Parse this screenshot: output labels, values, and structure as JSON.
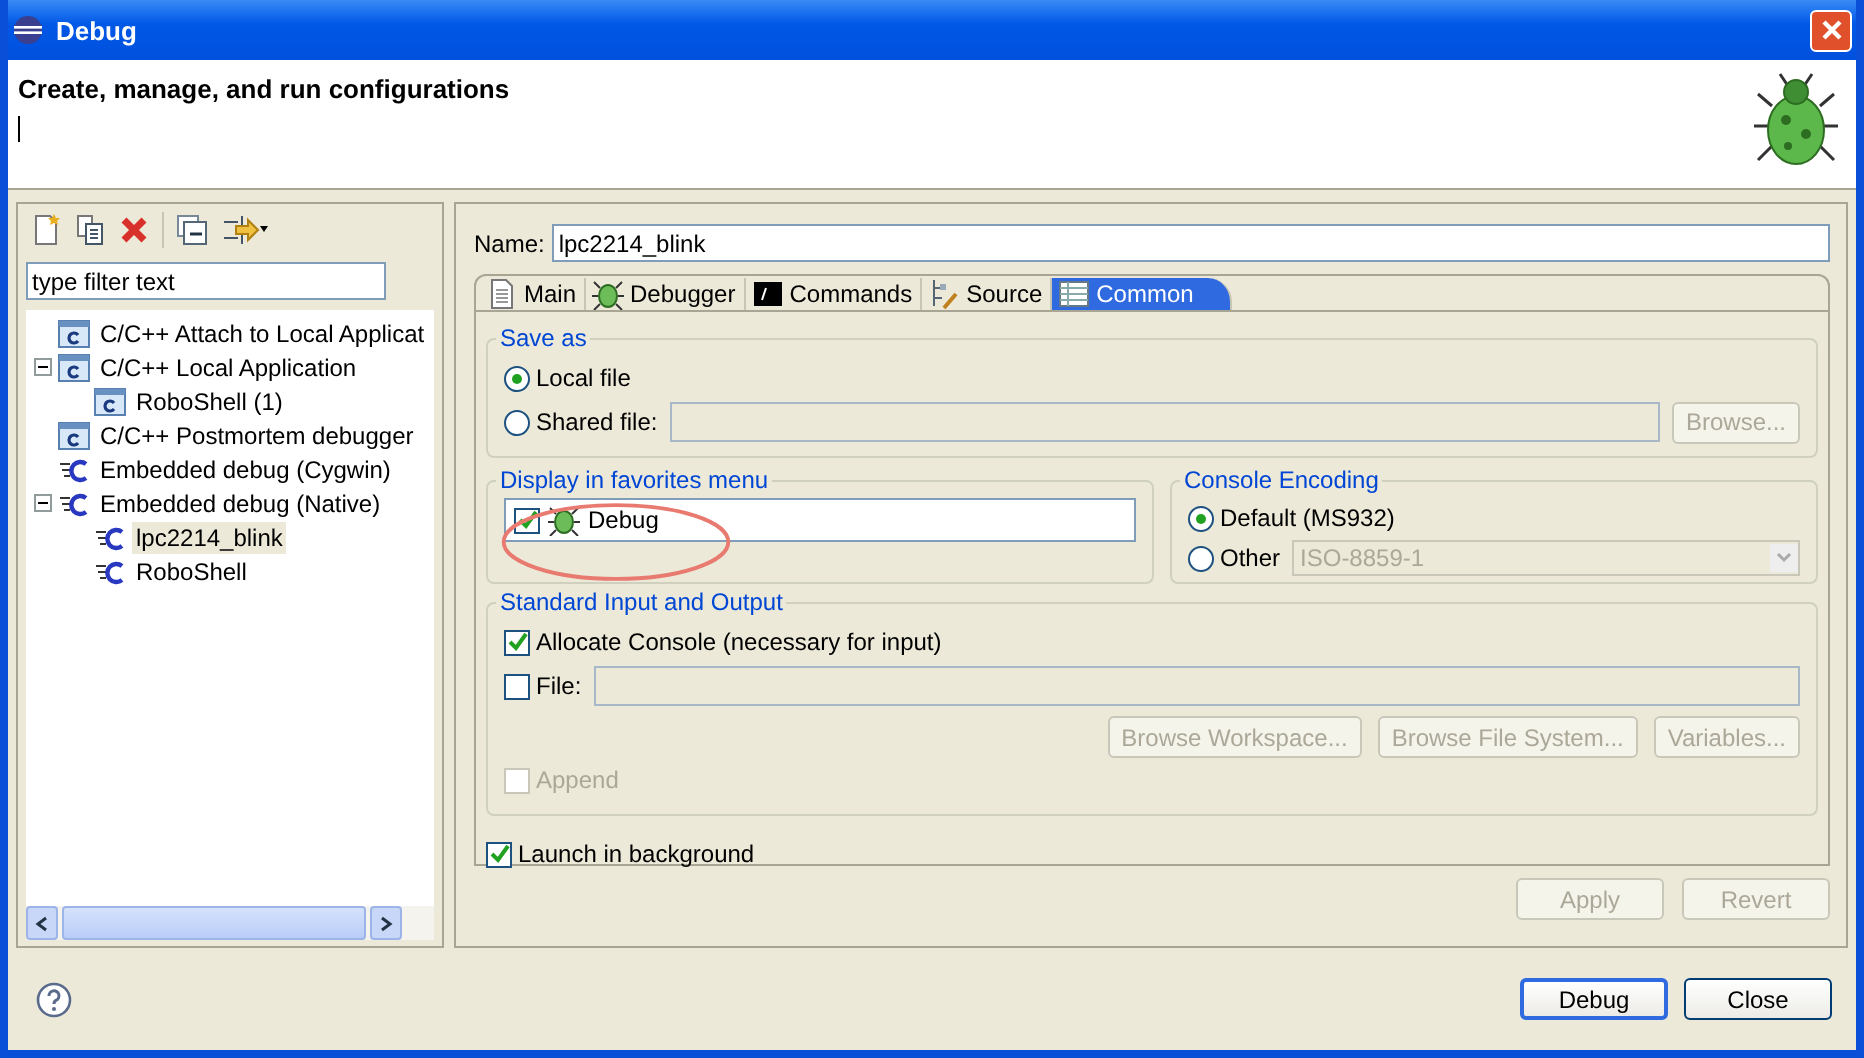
{
  "window": {
    "title": "Debug"
  },
  "header": {
    "title": "Create, manage, and run configurations"
  },
  "filter": {
    "placeholder": "type filter text"
  },
  "tree": [
    {
      "label": "C/C++ Attach to Local Applicat",
      "kind": "window",
      "selected": false
    },
    {
      "label": "C/C++ Local Application",
      "kind": "window",
      "selected": false,
      "expanded": true,
      "children": [
        {
          "label": "RoboShell (1)",
          "kind": "window",
          "selected": false
        }
      ]
    },
    {
      "label": "C/C++ Postmortem debugger",
      "kind": "window",
      "selected": false
    },
    {
      "label": "Embedded debug (Cygwin)",
      "kind": "embedded",
      "selected": false
    },
    {
      "label": "Embedded debug (Native)",
      "kind": "embedded",
      "selected": false,
      "expanded": true,
      "children": [
        {
          "label": "lpc2214_blink",
          "kind": "embedded",
          "selected": true
        },
        {
          "label": "RoboShell",
          "kind": "embedded",
          "selected": false
        }
      ]
    }
  ],
  "name_field": {
    "label": "Name:",
    "value": "lpc2214_blink"
  },
  "tabs": [
    {
      "label": "Main",
      "kind": "page",
      "selected": false
    },
    {
      "label": "Debugger",
      "kind": "bug",
      "selected": false
    },
    {
      "label": "Commands",
      "kind": "console",
      "selected": false
    },
    {
      "label": "Source",
      "kind": "source",
      "selected": false
    },
    {
      "label": "Common",
      "kind": "table",
      "selected": true
    }
  ],
  "save_as": {
    "title": "Save as",
    "options": [
      {
        "label": "Local file",
        "selected": true
      },
      {
        "label": "Shared file:",
        "selected": false
      }
    ],
    "browse": {
      "label": "Browse...",
      "disabled": true
    }
  },
  "favorites": {
    "title": "Display in favorites menu",
    "items": [
      {
        "label": "Debug",
        "checked": true
      }
    ]
  },
  "console_encoding": {
    "title": "Console Encoding",
    "options": [
      {
        "label": "Default (MS932)",
        "selected": true
      },
      {
        "label": "Other",
        "selected": false
      }
    ],
    "encoding": "ISO-8859-1"
  },
  "std_io": {
    "title": "Standard Input and Output",
    "allocate": {
      "label": "Allocate Console (necessary for input)",
      "checked": true
    },
    "file": {
      "label": "File:",
      "checked": false
    },
    "buttons": [
      {
        "label": "Browse Workspace...",
        "disabled": true
      },
      {
        "label": "Browse File System...",
        "disabled": true
      },
      {
        "label": "Variables...",
        "disabled": true
      }
    ],
    "append": {
      "label": "Append",
      "checked": false,
      "disabled": true
    }
  },
  "launch_background": {
    "label": "Launch in background",
    "checked": true
  },
  "panel_buttons": [
    {
      "label": "Apply",
      "disabled": true
    },
    {
      "label": "Revert",
      "disabled": true
    }
  ],
  "dialog_buttons": [
    {
      "label": "Debug",
      "default": true
    },
    {
      "label": "Close",
      "default": false
    }
  ]
}
